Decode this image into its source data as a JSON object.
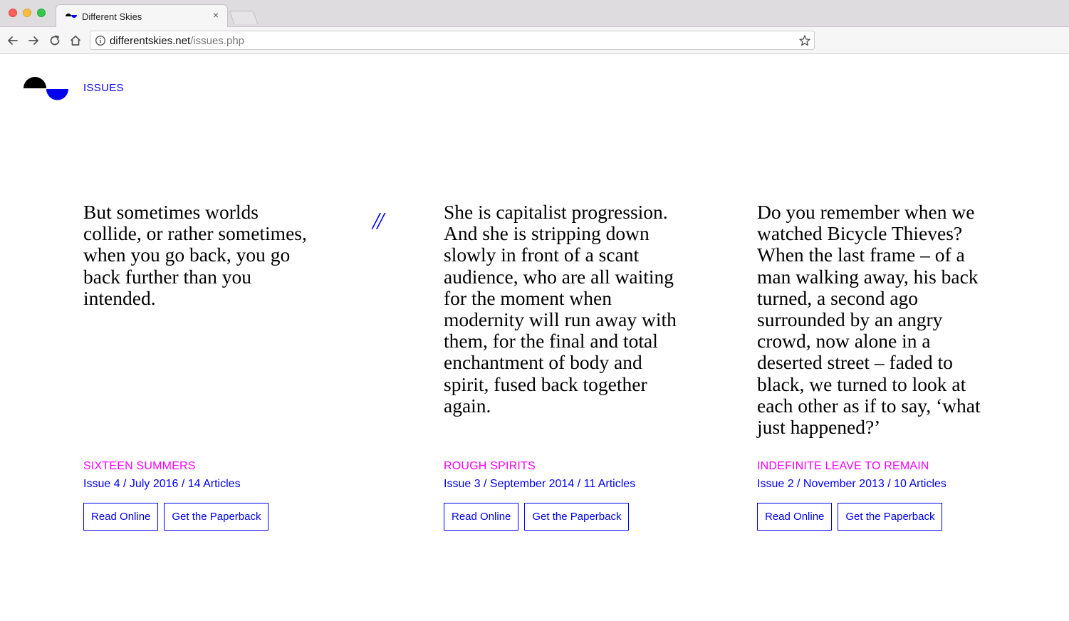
{
  "browser": {
    "tab_title": "Different Skies",
    "url_domain": "differentskies.net",
    "url_path": "/issues.php"
  },
  "nav": {
    "issues_link": "ISSUES"
  },
  "separator": "//",
  "colors": {
    "link": "#0000ee",
    "accent": "#ff00ff",
    "text": "#000000"
  },
  "issues": [
    {
      "quote": "But sometimes worlds collide, or rather sometimes, when you go back, you go back further than you intended.",
      "title": "SIXTEEN SUMMERS",
      "meta": "Issue 4 / July 2016 / 14 Articles",
      "read_label": "Read Online",
      "paperback_label": "Get the Paperback"
    },
    {
      "quote": "She is capitalist progression. And she is stripping down slowly in front of a scant audience, who are all waiting for the moment when modernity will run away with them, for the final and total enchantment of body and spirit, fused back together again.",
      "title": "ROUGH SPIRITS",
      "meta": "Issue 3 / September 2014 / 11 Articles",
      "read_label": "Read Online",
      "paperback_label": "Get the Paperback"
    },
    {
      "quote": "Do you remember when we watched Bicycle Thieves? When the last frame – of a man walking away, his back turned, a second ago surrounded by an angry crowd, now alone in a deserted street – faded to black, we turned to look at each other as if to say, ‘what just happened?’",
      "title": "INDEFINITE LEAVE TO REMAIN",
      "meta": "Issue 2 / November 2013 / 10 Articles",
      "read_label": "Read Online",
      "paperback_label": "Get the Paperback"
    }
  ]
}
